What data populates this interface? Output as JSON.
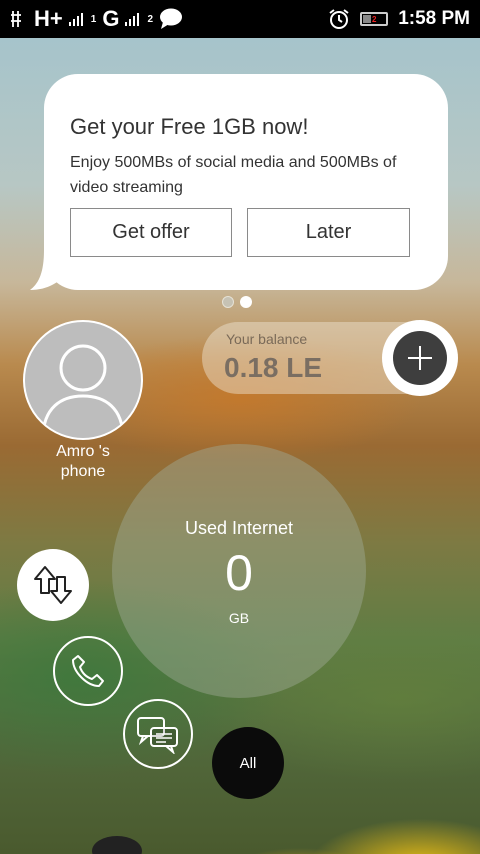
{
  "status_bar": {
    "network_1": "H+",
    "network_2": "G",
    "sim1": "1",
    "sim2": "2",
    "battery_level": "2",
    "time": "1:58 PM"
  },
  "offer": {
    "title": "Get your Free 1GB now!",
    "description": "Enjoy 500MBs of social media and 500MBs of video streaming",
    "primary_button": "Get offer",
    "secondary_button": "Later",
    "page_count": 2,
    "active_page": 2
  },
  "profile": {
    "name": "Amro 's phone"
  },
  "balance": {
    "label": "Your balance",
    "value": "0.18 LE",
    "add_icon": "plus-icon"
  },
  "usage": {
    "title": "Used Internet",
    "value": "0",
    "unit": "GB"
  },
  "filters": {
    "data_icon": "data-arrows-icon",
    "call_icon": "phone-icon",
    "message_icon": "chat-icon",
    "all_label": "All"
  },
  "colors": {
    "accent_dark": "#3e3e3e",
    "bubble": "#ffffff"
  }
}
